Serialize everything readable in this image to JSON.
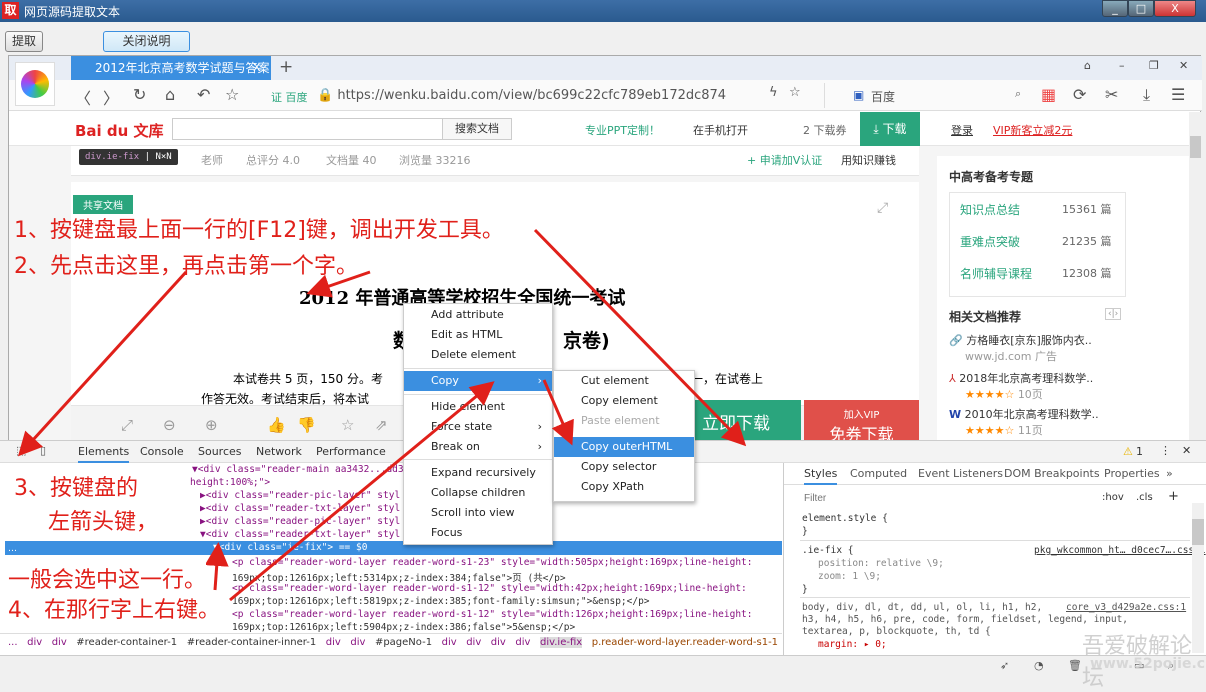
{
  "window": {
    "icon": "取",
    "title": "网页源码提取文本",
    "controls": [
      "_",
      "□",
      "X"
    ]
  },
  "toolbar": {
    "extract": "提取",
    "close_help": "关闭说明"
  },
  "browser": {
    "tab_title": "2012年北京高考数学试题与答案",
    "tab_close": "X",
    "new_tab": "+",
    "address": {
      "badge": "证 百度",
      "url": "https://wenku.baidu.com/view/bc699c22cfc789eb172dc874",
      "search_engine": "百度"
    }
  },
  "page": {
    "logo": "Bai du 文库",
    "search_button": "搜索文档",
    "ppt": "专业PPT定制！",
    "mobile": "在手机打开",
    "download_coupon": "2 下载券",
    "download": "下载",
    "login": "登录",
    "vip": "VIP新客立减2元",
    "tooltip": {
      "selector": "div.ie-fix",
      "size": "N×N"
    },
    "meta": [
      "老师",
      "总评分 4.0",
      "文档量 40",
      "浏览量 33216"
    ],
    "apply_v": "+ 申请加V认证",
    "earn": "用知识赚钱",
    "shared_badge": "共享文档",
    "doc_title": "2012 年普通高等学校招生全国统一考试",
    "doc_subtitle_left": "数",
    "doc_subtitle_right": "京卷)",
    "doc_line1": "本试卷共 5 页，150 分。考",
    "doc_line1b": "一，在试卷上",
    "doc_line2": "作答无效。考试结束后，将本试",
    "buy_now": "立即下载",
    "vip_top": "加入VIP",
    "vip_free": "免券下载",
    "sidebar": {
      "topic_title": "中高考备考专题",
      "topics": [
        {
          "name": "知识点总结",
          "count": "15361 篇"
        },
        {
          "name": "重难点突破",
          "count": "21235 篇"
        },
        {
          "name": "名师辅导课程",
          "count": "12308 篇"
        }
      ],
      "related_title": "相关文档推荐",
      "related": [
        {
          "title": "方格睡衣[京东]服饰内衣..",
          "sub": "www.jd.com  广告"
        },
        {
          "title": "2018年北京高考理科数学..",
          "sub": "10页"
        },
        {
          "title": "2010年北京高考理科数学..",
          "sub": "11页"
        }
      ]
    }
  },
  "instructions": [
    "1、按键盘最上面一行的[F12]键，调出开发工具。",
    "2、先点击这里，再点击第一个字。",
    "3、按键盘的",
    "左箭头键，",
    "一般会选中这一行。",
    "4、在那行字上右键。"
  ],
  "context_menu": [
    "Add attribute",
    "Edit as HTML",
    "Delete element",
    "Copy",
    "Hide element",
    "Force state",
    "Break on",
    "Expand recursively",
    "Collapse children",
    "Scroll into view",
    "Focus"
  ],
  "submenu": [
    "Cut element",
    "Copy element",
    "Paste element",
    "Copy outerHTML",
    "Copy selector",
    "Copy XPath"
  ],
  "devtools": {
    "tabs": [
      "Elements",
      "Console",
      "Sources",
      "Network",
      "Performance"
    ],
    "warning_count": "1",
    "code_lines": [
      "▼<div class=\"reader-main aa3432...dd33...\" style=\"...;width:100%;",
      "height:100%;\">",
      "▶<div class=\"reader-pic-layer\" styl",
      "▶<div class=\"reader-txt-layer\" styl",
      "▶<div class=\"reader-pic-layer\" styl",
      "▼<div class=\"reader-txt-layer\" styl",
      "▼<div class=\"ie-fix\"> == $0",
      "<p class=\"reader-word-layer reader-word-s1-23\" style=\"width:505px;height:169px;line-height:",
      "169px;top:12616px;left:5314px;z-index:384;false\">页 (共</p>",
      "<p class=\"reader-word-layer reader-word-s1-12\" style=\"width:42px;height:169px;line-height:",
      "169px;top:12616px;left:5819px;z-index:385;font-family:simsun;\">&ensp;</p>",
      "<p class=\"reader-word-layer reader-word-s1-12\" style=\"width:126px;height:169px;line-height:",
      "169px;top:12616px;left:5904px;z-index:386;false\">5&ensp;</p>"
    ],
    "breadcrumb": [
      "...",
      "div",
      "div",
      "#reader-container-1",
      "#reader-container-inner-1",
      "div",
      "div",
      "#pageNo-1",
      "div",
      "div",
      "div",
      "div",
      "div.ie-fix",
      "p.reader-word-layer.reader-word-s1-1"
    ],
    "style_tabs": [
      "Styles",
      "Computed",
      "Event Listeners",
      "DOM Breakpoints",
      "Properties",
      "»"
    ],
    "filter_placeholder": "Filter",
    "hov": ":hov",
    "cls": ".cls",
    "plus": "+",
    "styles": [
      "element.style {",
      "}",
      ".ie-fix {",
      "position: relative \\9;",
      "zoom: 1 \\9;",
      "}",
      "body, div, dl, dt, dd, ul, ol, li, h1, h2,",
      "h3, h4, h5, h6, pre, code, form, fieldset, legend, input,",
      "textarea, p, blockquote, th, td {",
      "margin: ▸ 0;"
    ],
    "style_sources": [
      "pkg_wkcommon_ht… d0cec7….css:1",
      "core_v3_d429a2e.css:1"
    ]
  },
  "watermark": {
    "line1": "吾爱破解论坛",
    "line2": "www.52pojie.cn"
  },
  "colors": {
    "accent": "#3b8fe0",
    "annotation": "#e0201a",
    "green": "#2aa57d",
    "vip_red": "#e0504a"
  }
}
